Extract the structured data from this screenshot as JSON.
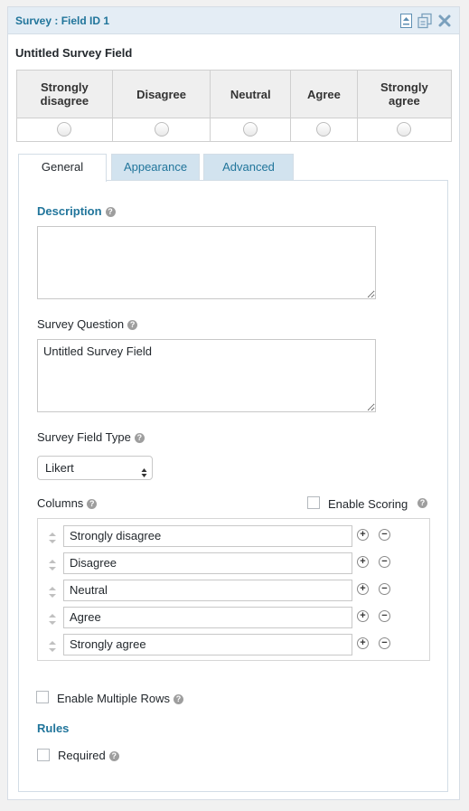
{
  "header": {
    "title": "Survey : Field ID 1"
  },
  "field": {
    "label": "Untitled Survey Field"
  },
  "preview": {
    "columns": [
      "Strongly\ndisagree",
      "Disagree",
      "Neutral",
      "Agree",
      "Strongly\nagree"
    ]
  },
  "tabs": [
    {
      "label": "General",
      "active": true
    },
    {
      "label": "Appearance",
      "active": false
    },
    {
      "label": "Advanced",
      "active": false
    }
  ],
  "general": {
    "description_label": "Description",
    "description_value": "",
    "question_label": "Survey Question",
    "question_value": "Untitled Survey Field",
    "type_label": "Survey Field Type",
    "type_value": "Likert",
    "columns_label": "Columns",
    "enable_scoring_label": "Enable Scoring",
    "enable_scoring_checked": false,
    "columns": [
      "Strongly disagree",
      "Disagree",
      "Neutral",
      "Agree",
      "Strongly agree"
    ],
    "enable_multiple_rows_label": "Enable Multiple Rows",
    "enable_multiple_rows_checked": false,
    "rules_label": "Rules",
    "required_label": "Required",
    "required_checked": false
  },
  "icons": {
    "help": "?",
    "add": "+",
    "remove": "−"
  },
  "colors": {
    "accent": "#21759b",
    "header_bg": "#e4edf5",
    "tab_inactive_bg": "#d2e3ef"
  }
}
